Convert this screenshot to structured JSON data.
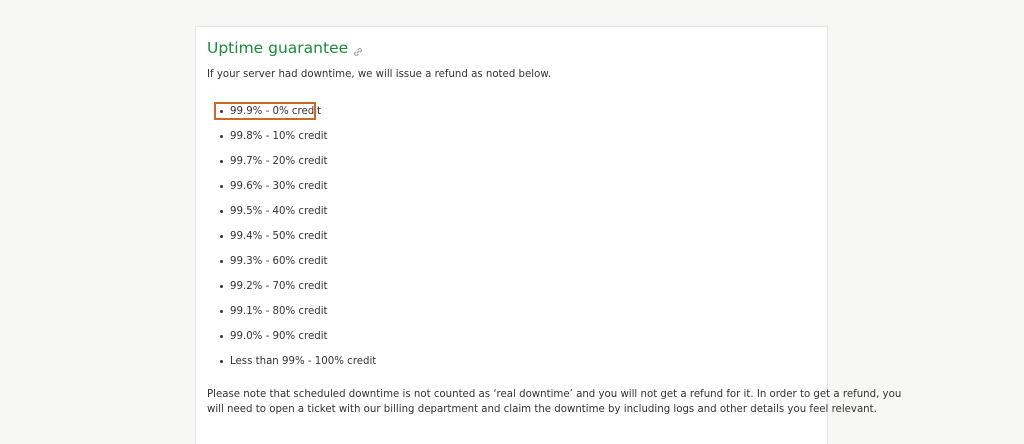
{
  "section": {
    "title": "Uptime guarantee",
    "anchor_icon": "link-icon",
    "intro": "If your server had downtime, we will issue a refund as noted below."
  },
  "credits": [
    "99.9% - 0% credit",
    "99.8% - 10% credit",
    "99.7% - 20% credit",
    "99.6% - 30% credit",
    "99.5% - 40% credit",
    "99.4% - 50% credit",
    "99.3% - 60% credit",
    "99.2% - 70% credit",
    "99.1% - 80% credit",
    "99.0% - 90% credit",
    "Less than 99% - 100% credit"
  ],
  "note": {
    "line1": "Please note that scheduled downtime is not counted as ‘real downtime’ and you will not get a refund for it. In order to get a refund, you",
    "line2": "will need to open a ticket with our billing department and claim the downtime by including logs and other details you feel relevant."
  },
  "colors": {
    "title": "#1e8a3c",
    "highlight": "#c96a28",
    "text": "#333333"
  }
}
